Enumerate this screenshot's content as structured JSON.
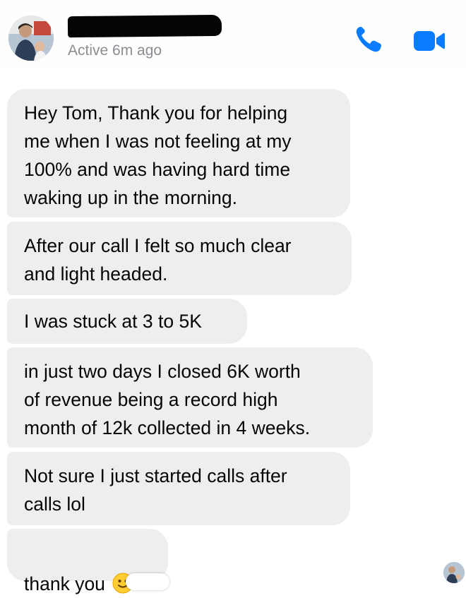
{
  "header": {
    "contact_name": "",
    "status": "Active 6m ago",
    "call_icon": "phone-icon",
    "video_icon": "video-camera-icon"
  },
  "colors": {
    "accent": "#0a7cff",
    "bubble": "#eeeeef",
    "status_text": "#8a8d91"
  },
  "messages": [
    {
      "text": "Hey Tom, Thank you for helping\nme when I was not feeling at my\n100% and was having hard time\nwaking up in the morning."
    },
    {
      "text": "After our call I felt so much clear\nand light headed."
    },
    {
      "text": "I was stuck at 3 to 5K"
    },
    {
      "text": "in just two days I closed 6K worth\nof revenue being a record high\nmonth of 12k collected in 4 weeks."
    },
    {
      "text": "Not sure I just started calls after\ncalls lol"
    },
    {
      "text": "thank you",
      "emoji": "slightly-smiling-face-icon"
    }
  ]
}
